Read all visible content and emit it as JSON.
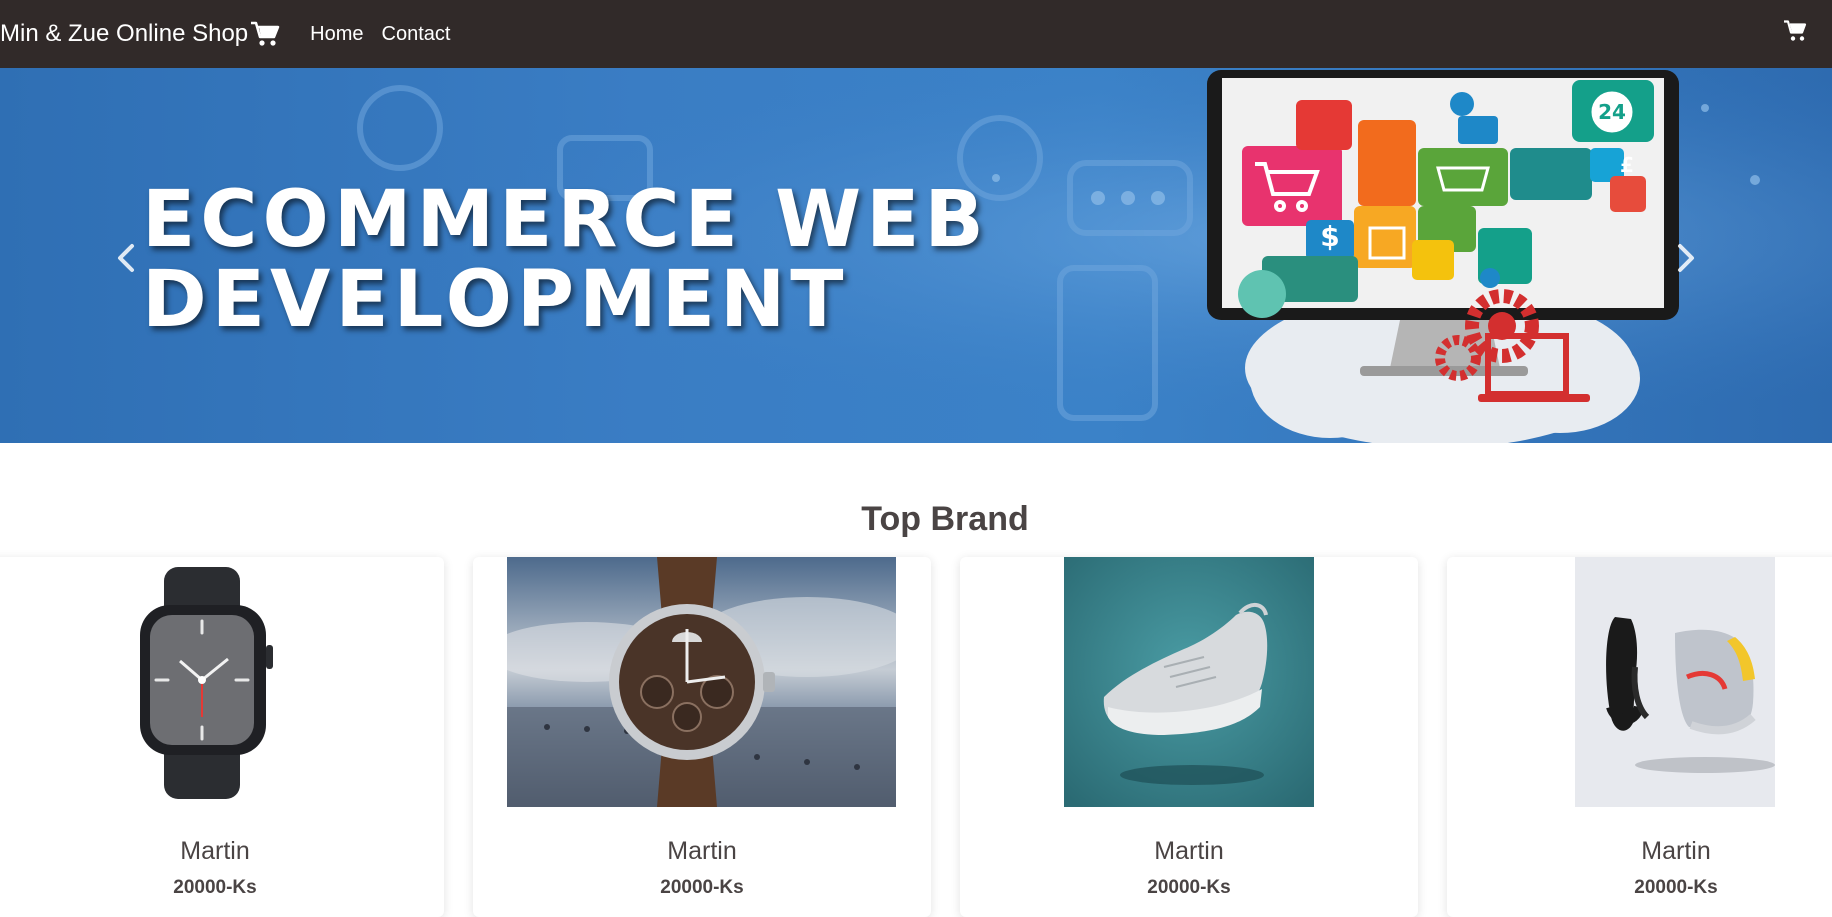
{
  "navbar": {
    "brand": "Min & Zue Online Shop",
    "links": [
      "Home",
      "Contact"
    ],
    "brand_icon": "cart-icon",
    "cart_icon": "cart-icon"
  },
  "carousel": {
    "headline_line1": "ECOMMERCE WEB",
    "headline_line2": "DEVELOPMENT",
    "prev_icon": "chevron-left-icon",
    "next_icon": "chevron-right-icon",
    "badge_text": "24"
  },
  "section": {
    "title": "Top Brand"
  },
  "products": [
    {
      "name": "Martin",
      "price": "20000-Ks",
      "image": "smartwatch"
    },
    {
      "name": "Martin",
      "price": "20000-Ks",
      "image": "wristwatch"
    },
    {
      "name": "Martin",
      "price": "20000-Ks",
      "image": "sneaker-teal"
    },
    {
      "name": "Martin",
      "price": "20000-Ks",
      "image": "sneakers-pair"
    }
  ],
  "colors": {
    "navbar_bg": "#312a29",
    "hero_blue": "#3a7dc4",
    "text_dark": "#4a4444"
  }
}
